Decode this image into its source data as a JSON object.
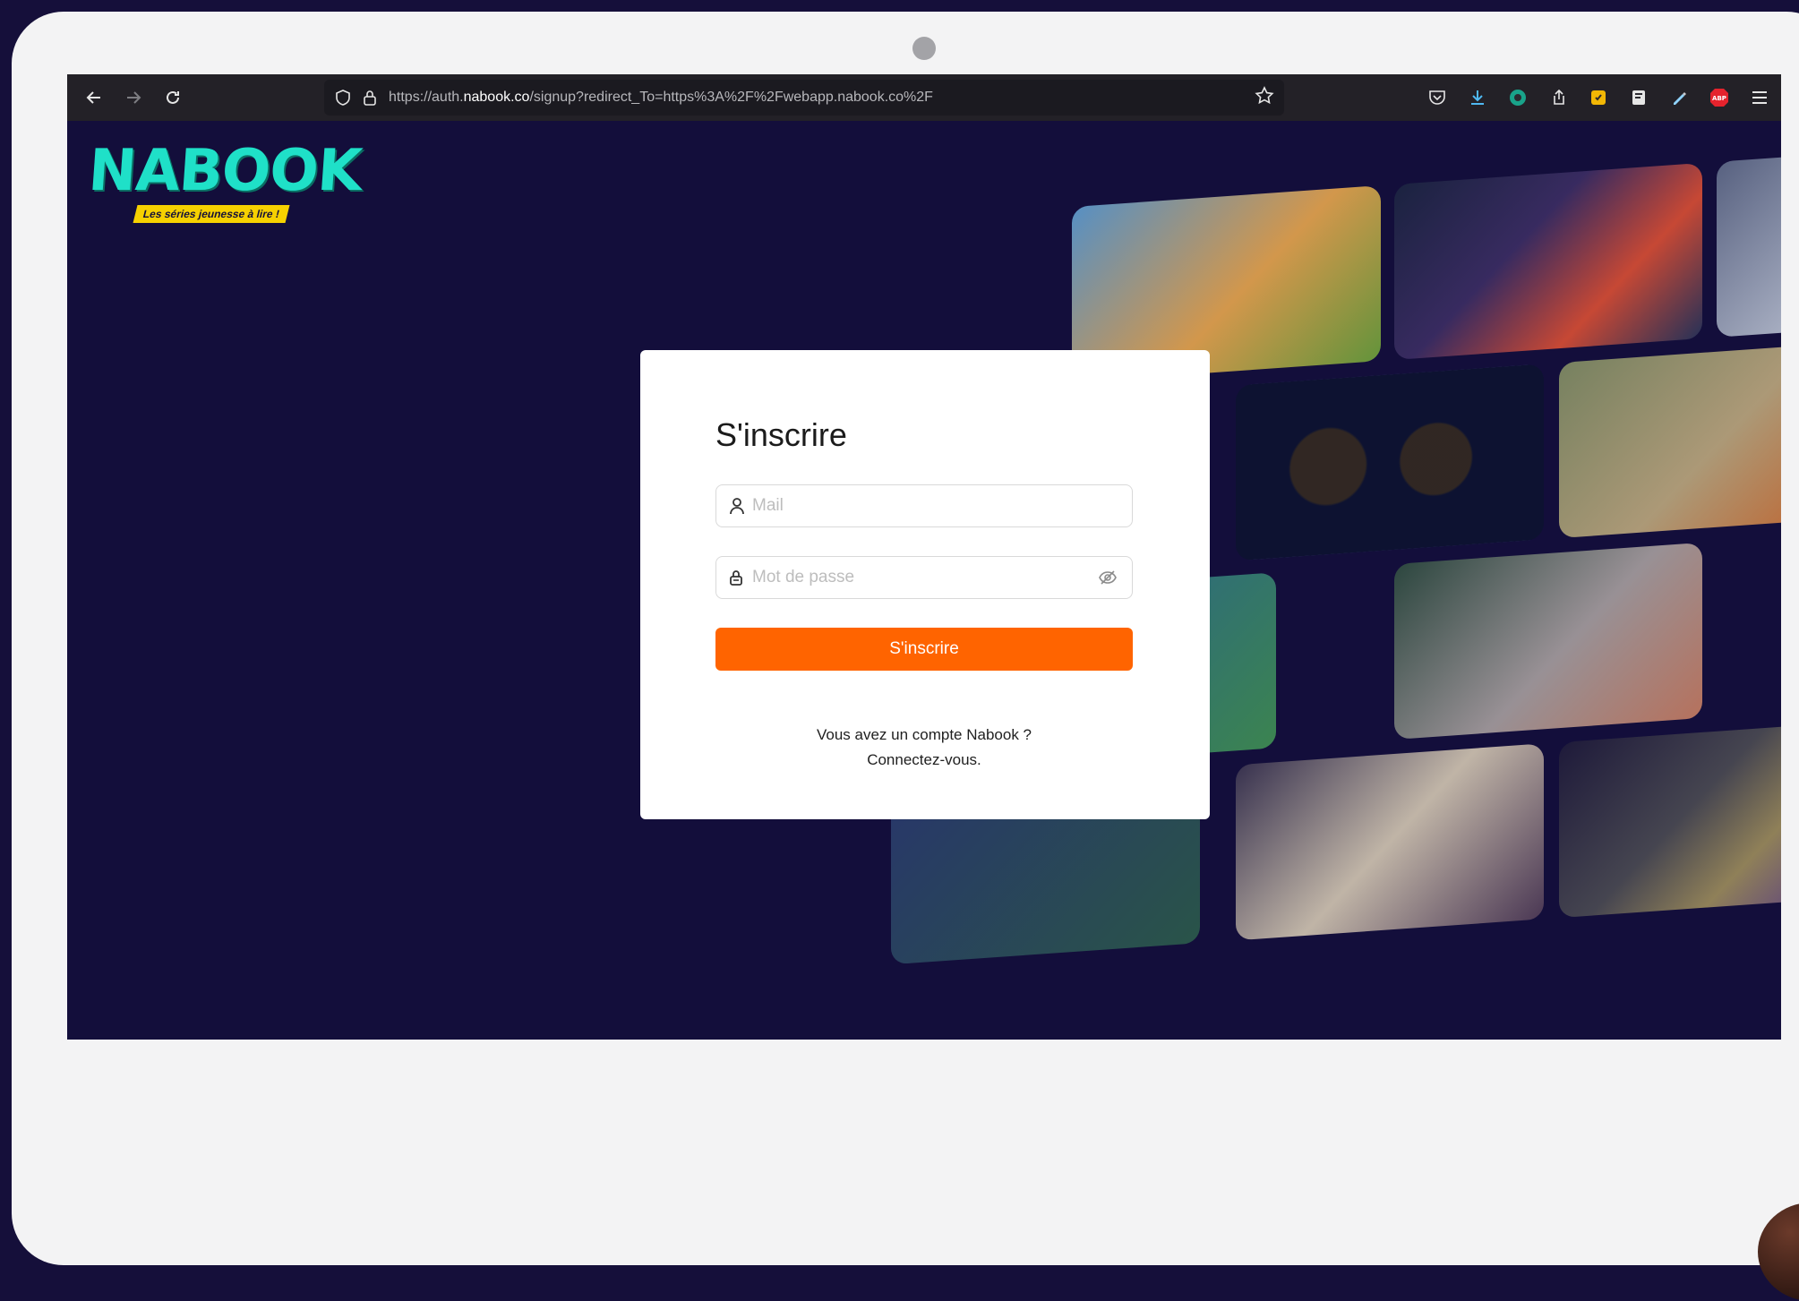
{
  "browser": {
    "url_prefix": "https://auth.",
    "url_domain": "nabook.co",
    "url_suffix": "/signup?redirect_To=https%3A%2F%2Fwebapp.nabook.co%2F"
  },
  "brand": {
    "logo_text": "NABOOK",
    "tagline": "Les séries jeunesse à lire !"
  },
  "signup": {
    "title": "S'inscrire",
    "email_placeholder": "Mail",
    "password_placeholder": "Mot de passe",
    "submit_label": "S'inscrire",
    "account_question": "Vous avez un compte Nabook ?",
    "login_link": "Connectez-vous."
  },
  "colors": {
    "accent": "#ff6400",
    "brand": "#1fe0c8",
    "background": "#130e3b"
  }
}
